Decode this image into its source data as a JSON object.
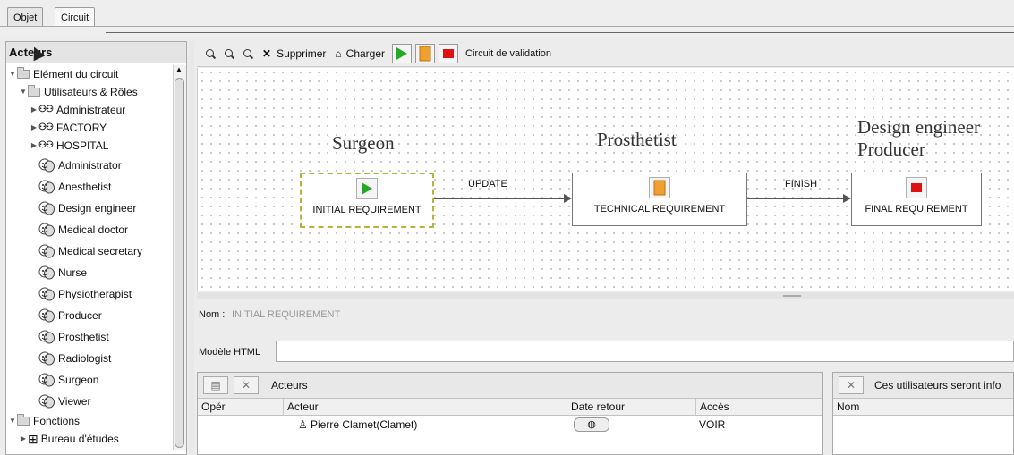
{
  "tabs": [
    "Objet",
    "Circuit"
  ],
  "left_panel": {
    "title": "Acteurs",
    "tree": [
      {
        "label": "Elément du circuit",
        "level": 0,
        "expanded": true,
        "icon": "folder-icon"
      },
      {
        "label": "Utilisateurs & Rôles",
        "level": 1,
        "expanded": true,
        "icon": "folder-icon"
      },
      {
        "label": "Administrateur",
        "level": 2,
        "expanded": false,
        "icon": "group-icon"
      },
      {
        "label": "FACTORY",
        "level": 2,
        "expanded": false,
        "icon": "group-icon"
      },
      {
        "label": "HOSPITAL",
        "level": 2,
        "expanded": false,
        "icon": "group-icon"
      },
      {
        "label": "Administrator",
        "level": 2,
        "icon": "role-mask-icon"
      },
      {
        "label": "Anesthetist",
        "level": 2,
        "icon": "role-mask-icon"
      },
      {
        "label": "Design engineer",
        "level": 2,
        "icon": "role-mask-icon"
      },
      {
        "label": "Medical doctor",
        "level": 2,
        "icon": "role-mask-icon"
      },
      {
        "label": "Medical secretary",
        "level": 2,
        "icon": "role-mask-icon"
      },
      {
        "label": "Nurse",
        "level": 2,
        "icon": "role-mask-icon"
      },
      {
        "label": "Physiotherapist",
        "level": 2,
        "icon": "role-mask-icon"
      },
      {
        "label": "Producer",
        "level": 2,
        "icon": "role-mask-icon"
      },
      {
        "label": "Prosthetist",
        "level": 2,
        "icon": "role-mask-icon"
      },
      {
        "label": "Radiologist",
        "level": 2,
        "icon": "role-mask-icon"
      },
      {
        "label": "Surgeon",
        "level": 2,
        "icon": "role-mask-icon"
      },
      {
        "label": "Viewer",
        "level": 2,
        "icon": "role-mask-icon"
      },
      {
        "label": "Fonctions",
        "level": 0,
        "expanded": true,
        "icon": "folder-icon"
      },
      {
        "label": "Bureau d'études",
        "level": 1,
        "expanded": false,
        "icon": "org-grid-icon"
      }
    ]
  },
  "toolbar": {
    "delete_label": "Supprimer",
    "load_label": "Charger",
    "circuit_label": "Circuit de validation",
    "play_color": "#22aa22",
    "doc_color": "#f0a030",
    "stop_color": "#dd1111"
  },
  "diagram": {
    "lanes": [
      "Surgeon",
      "Prosthetist",
      "Design engineer\nProducer"
    ],
    "nodes": [
      {
        "label": "INITIAL REQUIREMENT",
        "icon": "play-icon"
      },
      {
        "label": "TECHNICAL REQUIREMENT",
        "icon": "document-icon"
      },
      {
        "label": "FINAL REQUIREMENT",
        "icon": "stop-icon"
      }
    ],
    "edges": [
      "UPDATE",
      "FINISH"
    ]
  },
  "form": {
    "nom_label": "Nom :",
    "nom_value": "INITIAL REQUIREMENT",
    "html_label": "Modèle HTML",
    "html_value": ""
  },
  "actors_panel": {
    "title": "Acteurs",
    "columns": [
      "Opér",
      "Acteur",
      "Date retour",
      "Accès"
    ],
    "rows": [
      {
        "oper": "",
        "acteur": "Pierre Clamet(Clamet)",
        "date_retour": "",
        "acces": "VOIR"
      }
    ]
  },
  "info_panel": {
    "title": "Ces utilisateurs seront info",
    "columns": [
      "Nom"
    ]
  }
}
